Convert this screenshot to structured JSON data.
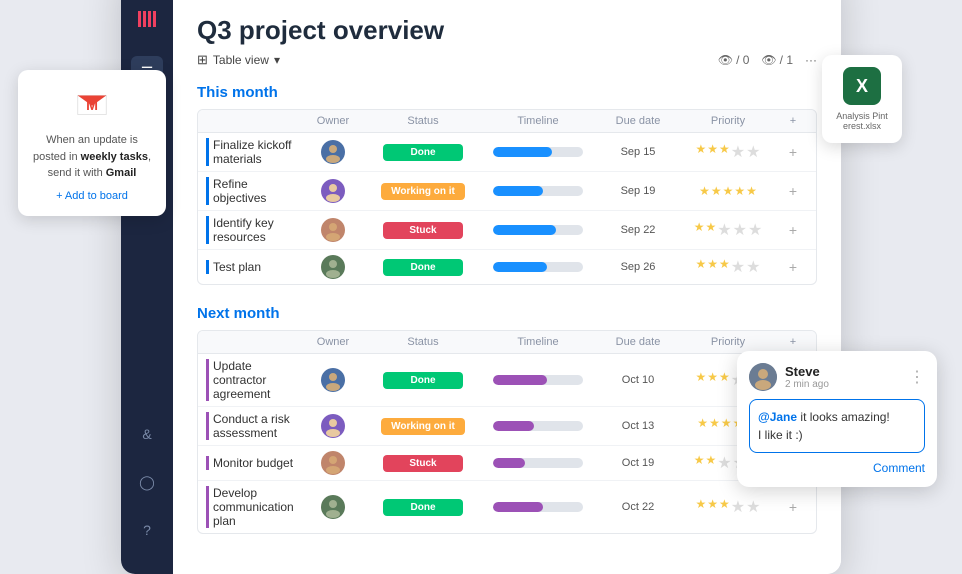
{
  "gmail_card": {
    "icon": "M",
    "text_before": "When an update is posted in ",
    "bold1": "weekly tasks",
    "text_middle": ", send it with ",
    "bold2": "Gmail",
    "link": "+ Add to board"
  },
  "excel_card": {
    "label": "Analysis Pinterest.xlsx"
  },
  "comment_card": {
    "user": "Steve",
    "time": "2 min ago",
    "mention": "@Jane",
    "message": " it looks amazing!\nI like it :)",
    "action": "Comment"
  },
  "window": {
    "title": "Q3 project overview",
    "toolbar": {
      "view_label": "Table view",
      "stat1_icon": "👁",
      "stat1_val": "/ 0",
      "stat2_icon": "👁",
      "stat2_val": "/ 1",
      "more_icon": "···"
    }
  },
  "this_month": {
    "title": "This month",
    "columns": [
      "",
      "Owner",
      "Status",
      "Timeline",
      "Due date",
      "Priority",
      "+"
    ],
    "rows": [
      {
        "task": "Finalize kickoff materials",
        "owner_av": "av1",
        "status": "Done",
        "status_type": "done",
        "timeline_fill": 65,
        "timeline_type": "blue",
        "due": "Sep 15",
        "stars": 3
      },
      {
        "task": "Refine objectives",
        "owner_av": "av2",
        "status": "Working on it",
        "status_type": "working",
        "timeline_fill": 55,
        "timeline_type": "blue",
        "due": "Sep 19",
        "stars": 5
      },
      {
        "task": "Identify key resources",
        "owner_av": "av3",
        "status": "Stuck",
        "status_type": "stuck",
        "timeline_fill": 70,
        "timeline_type": "blue",
        "due": "Sep 22",
        "stars": 2
      },
      {
        "task": "Test plan",
        "owner_av": "av4",
        "status": "Done",
        "status_type": "done",
        "timeline_fill": 60,
        "timeline_type": "blue",
        "due": "Sep 26",
        "stars": 3
      }
    ]
  },
  "next_month": {
    "title": "Next month",
    "columns": [
      "",
      "Owner",
      "Status",
      "Timeline",
      "Due date",
      "Priority",
      "+"
    ],
    "rows": [
      {
        "task": "Update contractor agreement",
        "owner_av": "av1",
        "status": "Done",
        "status_type": "done",
        "timeline_fill": 60,
        "timeline_type": "purple",
        "due": "Oct 10",
        "stars": 3
      },
      {
        "task": "Conduct a risk assessment",
        "owner_av": "av2",
        "status": "Working on it",
        "status_type": "working",
        "timeline_fill": 45,
        "timeline_type": "purple",
        "due": "Oct 13",
        "stars": 4
      },
      {
        "task": "Monitor budget",
        "owner_av": "av3",
        "status": "Stuck",
        "status_type": "stuck",
        "timeline_fill": 35,
        "timeline_type": "purple",
        "due": "Oct 19",
        "stars": 2
      },
      {
        "task": "Develop communication plan",
        "owner_av": "av4",
        "status": "Done",
        "status_type": "done",
        "timeline_fill": 55,
        "timeline_type": "purple",
        "due": "Oct 22",
        "stars": 3
      }
    ]
  },
  "sidebar": {
    "logo": "//",
    "items": [
      "☰",
      "◎",
      "◻",
      "⬡"
    ],
    "bottom": [
      "&",
      "◯",
      "?"
    ]
  }
}
